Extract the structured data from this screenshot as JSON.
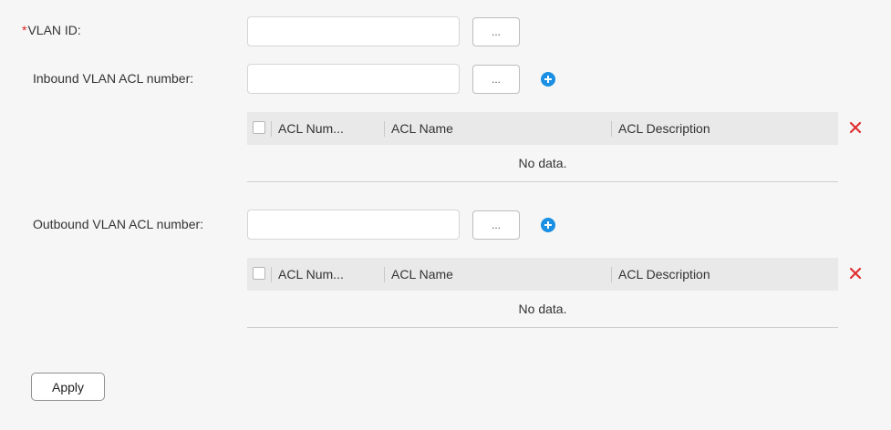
{
  "form": {
    "vlan_id": {
      "required_mark": "*",
      "label": "VLAN ID:",
      "value": "",
      "picker_label": "..."
    },
    "inbound": {
      "label": "Inbound VLAN ACL number:",
      "value": "",
      "picker_label": "...",
      "add_icon": "plus-circle-icon",
      "table": {
        "columns": [
          "ACL Num...",
          "ACL Name",
          "ACL Description"
        ],
        "empty_text": "No data.",
        "delete_icon": "close-icon"
      }
    },
    "outbound": {
      "label": "Outbound VLAN ACL number:",
      "value": "",
      "picker_label": "...",
      "add_icon": "plus-circle-icon",
      "table": {
        "columns": [
          "ACL Num...",
          "ACL Name",
          "ACL Description"
        ],
        "empty_text": "No data.",
        "delete_icon": "close-icon"
      }
    },
    "apply_label": "Apply"
  },
  "colors": {
    "background": "#f6f6f6",
    "accent": "#1a8fe3",
    "delete": "#e03030",
    "required": "#e02020",
    "table_header": "#e9e9e9"
  }
}
